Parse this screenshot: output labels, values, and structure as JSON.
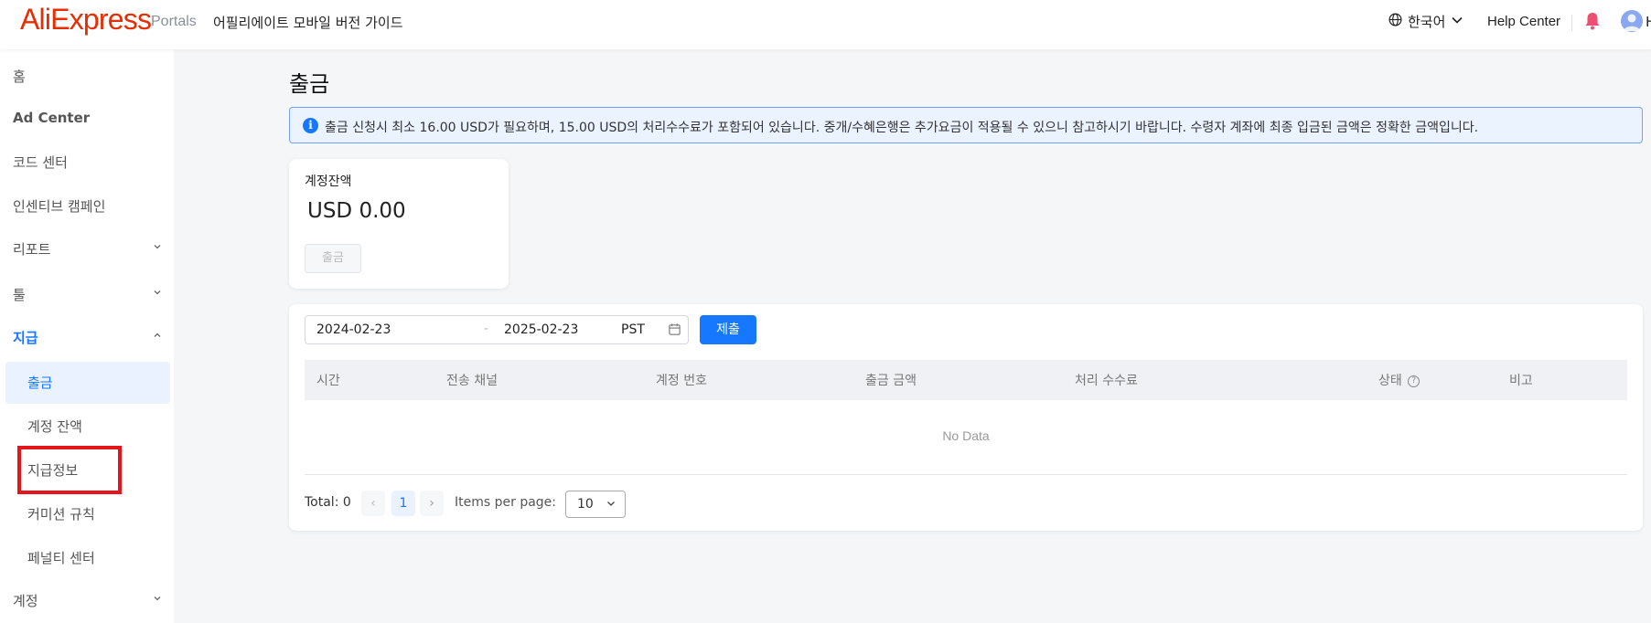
{
  "header": {
    "logo": "AliExpress",
    "logo_sub": "Portals",
    "guide": "어필리에이트 모바일 버전 가이드",
    "language": "한국어",
    "help": "Help Center",
    "avatar_letter": "H",
    "bell_color": "#ec4f72",
    "brand_color": "#e62e04",
    "icons": [
      "globe-icon",
      "chevron-down-icon",
      "bell-icon",
      "avatar-icon"
    ]
  },
  "sidebar": {
    "items": [
      {
        "label": "홈"
      },
      {
        "label": "Ad Center"
      },
      {
        "label": "코드 센터"
      },
      {
        "label": "인센티브 캠페인"
      },
      {
        "label": "리포트"
      },
      {
        "label": "툴"
      },
      {
        "label": "지급"
      },
      {
        "label": "출금"
      },
      {
        "label": "계정 잔액"
      },
      {
        "label": "지급정보"
      },
      {
        "label": "커미션 규칙"
      },
      {
        "label": "페널티 센터"
      },
      {
        "label": "계정"
      }
    ],
    "active_item": "출금",
    "accent": "#1677ff"
  },
  "main": {
    "title": "출금",
    "notice": "출금 신청시 최소 16.00 USD가 필요하며, 15.00 USD의 처리수수료가 포함되어 있습니다. 중개/수혜은행은 추가요금이 적용될 수 있으니 참고하시기 바랍니다. 수령자 계좌에 최종 입금된 금액은 정확한 금액입니다.",
    "balance": {
      "label": "계정잔액",
      "amount": "USD 0.00",
      "button": "출금"
    },
    "filter": {
      "start_date": "2024-02-23",
      "separator": "-",
      "end_date": "2025-02-23",
      "timezone": "PST",
      "submit": "제출"
    },
    "table": {
      "columns": [
        "시간",
        "전송 채널",
        "계정 번호",
        "출금 금액",
        "처리 수수료",
        "상태",
        "비고"
      ],
      "empty": "No Data"
    },
    "pagination": {
      "total": "Total: 0",
      "prev": "‹",
      "current": "1",
      "next": "›",
      "items_per_page_label": "Items per page:",
      "items_per_page": "10"
    }
  }
}
